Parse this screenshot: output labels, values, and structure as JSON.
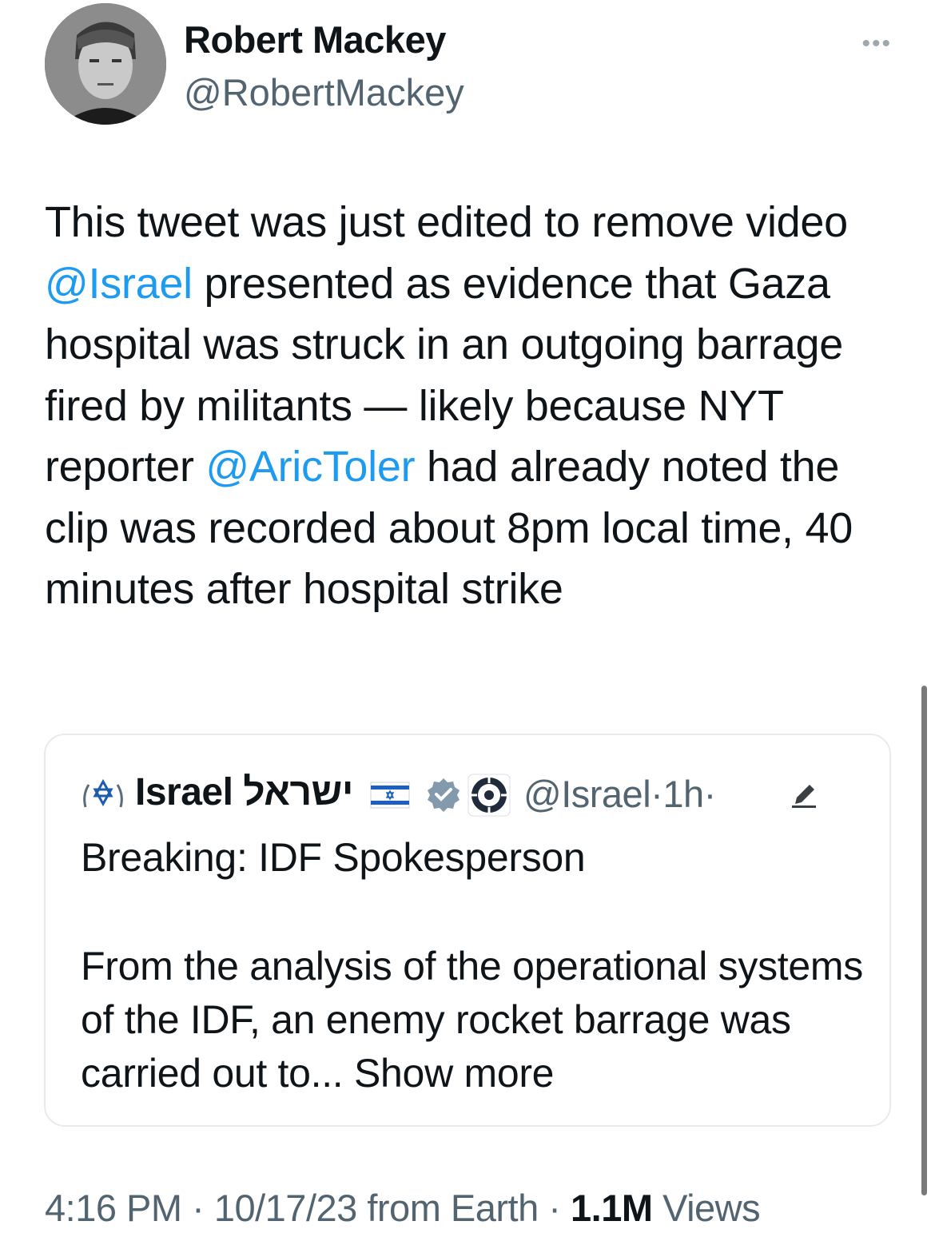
{
  "author": {
    "name": "Robert Mackey",
    "handle": "@RobertMackey",
    "more_icon": "more-horizontal-icon"
  },
  "tweet": {
    "text_1": "This tweet was just edited to remove video ",
    "mention_1": "@Israel",
    "text_2": " presented as evidence that Gaza hospital was struck in an outgoing barrage fired by militants — likely because NYT reporter ",
    "mention_2": "@AricToler",
    "text_3": " had already noted the clip was recorded about 8pm local time, 40 minutes after hospital strike"
  },
  "quote": {
    "name": "Israel ישראל",
    "handle": "@Israel",
    "dot_1": "·",
    "time": "1h",
    "dot_2": "·",
    "icons": [
      "star-of-david-icon",
      "israel-flag-icon",
      "verified-badge-icon",
      "government-seal-icon",
      "edited-pencil-icon"
    ],
    "line1": "Breaking: IDF Spokesperson",
    "body": "From the analysis of the operational systems of the IDF, an enemy rocket barrage was carried out to...",
    "show_more": "Show more"
  },
  "meta": {
    "time": "4:16 PM",
    "sep_1": " · ",
    "date": "10/17/23",
    "source": " from Earth",
    "sep_2": " · ",
    "views_count": "1.1M",
    "views_label": " Views"
  },
  "colors": {
    "link": "#1d9bf0",
    "secondary_text": "#536471",
    "primary_text": "#0f1419",
    "border": "#e8ebed"
  }
}
